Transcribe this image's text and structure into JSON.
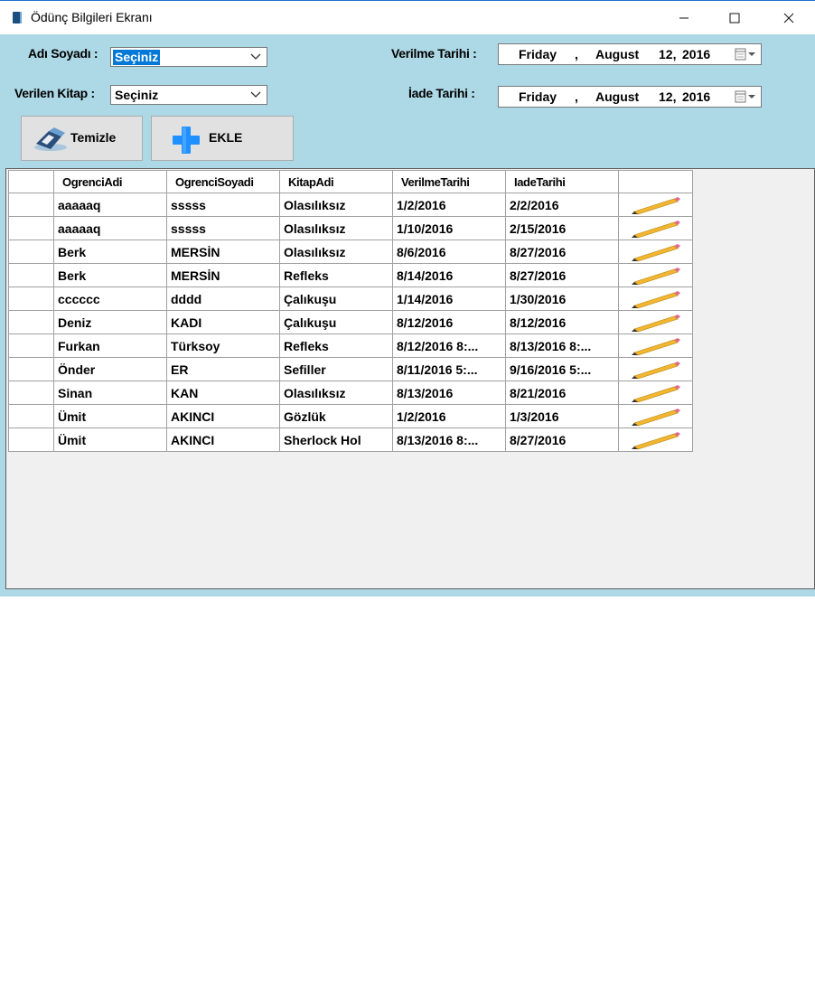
{
  "window": {
    "title": "Ödünç Bilgileri Ekranı",
    "min_glyph": "—",
    "max_glyph": "☐",
    "close_glyph": "✕"
  },
  "form": {
    "adi_soyadi_label": "Adı Soyadı :",
    "adi_soyadi_value": "Seçiniz",
    "verilen_kitap_label": "Verilen Kitap :",
    "verilen_kitap_value": "Seçiniz",
    "verilme_tarihi_label": "Verilme Tarihi :",
    "iade_tarihi_label": "İade Tarihi :",
    "verilme_date": {
      "weekday": "Friday",
      "sep": ",",
      "month": "August",
      "day": "12,",
      "year": "2016"
    },
    "iade_date": {
      "weekday": "Friday",
      "sep": ",",
      "month": "August",
      "day": "12,",
      "year": "2016"
    }
  },
  "buttons": {
    "temizle": "Temizle",
    "ekle": "EKLE"
  },
  "grid": {
    "columns": [
      "OgrenciAdi",
      "OgrenciSoyadi",
      "KitapAdi",
      "VerilmeTarihi",
      "IadeTarihi"
    ],
    "rows": [
      [
        "aaaaaq",
        "sssss",
        "Olasılıksız",
        "1/2/2016",
        "2/2/2016"
      ],
      [
        "aaaaaq",
        "sssss",
        "Olasılıksız",
        "1/10/2016",
        "2/15/2016"
      ],
      [
        "Berk",
        "MERSİN",
        "Olasılıksız",
        "8/6/2016",
        "8/27/2016"
      ],
      [
        "Berk",
        "MERSİN",
        "Refleks",
        "8/14/2016",
        "8/27/2016"
      ],
      [
        "cccccc",
        "dddd",
        "Çalıkuşu",
        "1/14/2016",
        "1/30/2016"
      ],
      [
        "Deniz",
        "KADI",
        "Çalıkuşu",
        "8/12/2016",
        "8/12/2016"
      ],
      [
        "Furkan",
        "Türksoy",
        "Refleks",
        "8/12/2016 8:...",
        "8/13/2016 8:..."
      ],
      [
        "Önder",
        "ER",
        "Sefiller",
        "8/11/2016 5:...",
        "9/16/2016 5:..."
      ],
      [
        "Sinan",
        "KAN",
        "Olasılıksız",
        "8/13/2016",
        "8/21/2016"
      ],
      [
        "Ümit",
        "AKINCI",
        "Gözlük",
        "1/2/2016",
        "1/3/2016"
      ],
      [
        "Ümit",
        "AKINCI",
        "Sherlock Hol",
        "8/13/2016 8:...",
        "8/27/2016"
      ]
    ],
    "edit_icon": "pencil-icon"
  },
  "colors": {
    "client_bg": "#add8e6",
    "selection": "#0078d7",
    "button_bg": "#e1e1e1",
    "plus_icon": "#1e90ff"
  }
}
